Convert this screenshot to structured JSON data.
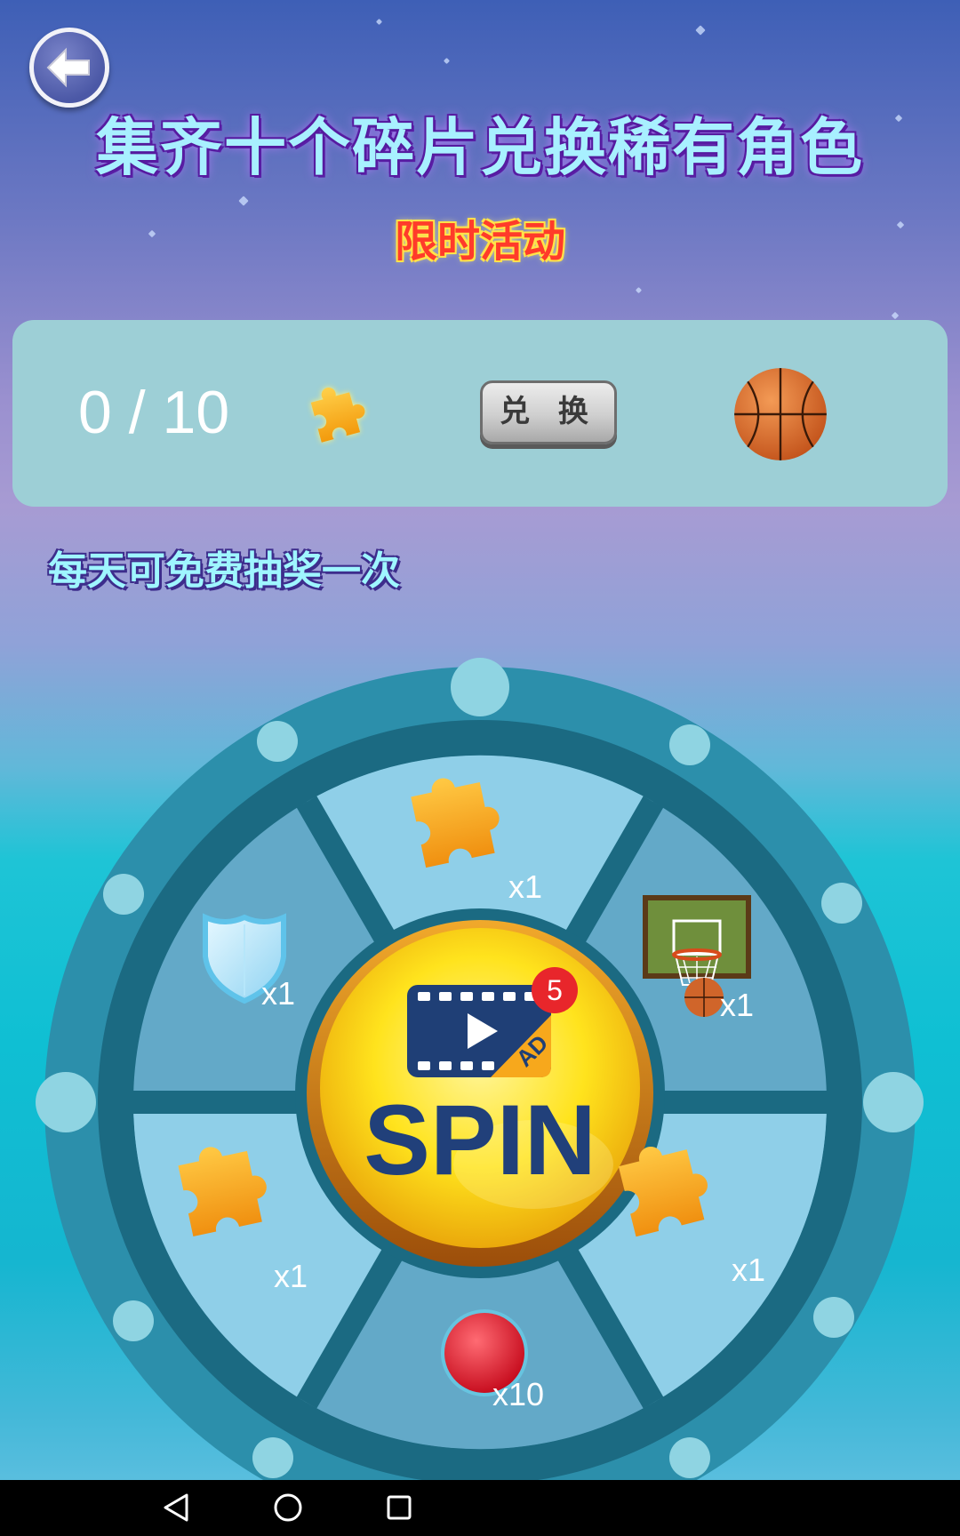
{
  "header": {
    "back_icon": "back-arrow-icon",
    "title": "集齐十个碎片兑换稀有角色",
    "subtitle": "限时活动"
  },
  "exchange_panel": {
    "counter": "0 / 10",
    "fragment_icon": "puzzle-piece-icon",
    "exchange_label": "兑 换",
    "reward_icon": "basketball-icon"
  },
  "daily_note": "每天可免费抽奖一次",
  "wheel": {
    "segments": [
      {
        "icon": "puzzle-piece-icon",
        "qty": "x1"
      },
      {
        "icon": "basketball-hoop-icon",
        "qty": "x1"
      },
      {
        "icon": "puzzle-piece-icon",
        "qty": "x1"
      },
      {
        "icon": "red-ball-icon",
        "qty": "x10"
      },
      {
        "icon": "puzzle-piece-icon",
        "qty": "x1"
      },
      {
        "icon": "shield-icon",
        "qty": "x1"
      }
    ],
    "spin_label": "SPIN",
    "ad_icon": "video-ad-icon",
    "ad_count": "5"
  },
  "navbar": {
    "back": "nav-back-icon",
    "home": "nav-home-icon",
    "recents": "nav-recents-icon"
  },
  "colors": {
    "wheel_outer": "#2c8fab",
    "wheel_divider": "#1b6a82",
    "segment_light": "#8fcfe8",
    "segment_mid": "#63a9c8",
    "spin_yellow": "#ffe21a",
    "spin_text": "#21407a"
  }
}
